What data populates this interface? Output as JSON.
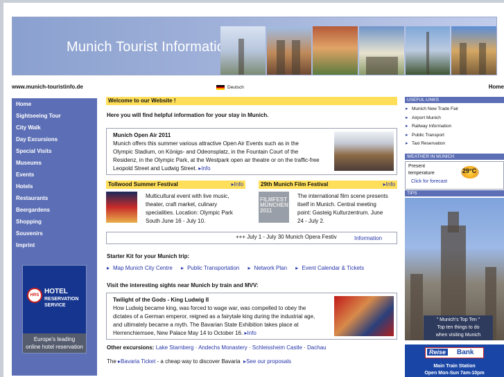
{
  "header": {
    "site_title": "Munich Tourist Information"
  },
  "topbar": {
    "url": "www.munich-touristinfo.de",
    "language": "Deutsch",
    "home": "Home"
  },
  "nav": {
    "items": [
      "Home",
      "Sightseeing Tour",
      "City Walk",
      "Day Excursions",
      "Special Visits",
      "Museums",
      "Events",
      "Hotels",
      "Restaurants",
      "Beergardens",
      "Shopping",
      "Souvenirs",
      "Imprint"
    ]
  },
  "hrs_ad": {
    "logo": "HRS",
    "line1": "HOTEL",
    "line2": "RESERVATION",
    "line3": "SERVICE",
    "caption_1": "Europe's leading",
    "caption_2": "online hotel reservation"
  },
  "main": {
    "welcome": "Welcome to our Website !",
    "intro": "Here you will find helpful information for your stay in Munich.",
    "open_air": {
      "title": "Munich Open Air 2011",
      "lines": [
        "Munich offers this summer various attractive Open Air Events such as in the",
        "Olympic Stadium, on Königs- and Odeonsplatz, in the Fountain Court of the",
        "Residenz, in the Olympic Park, at the Westpark open air theatre or on the traffic-free"
      ],
      "last_line": "Leopold Street and Ludwig Street.",
      "more": "Info"
    },
    "tollwood": {
      "title": "Tollwood Summer Festival",
      "more": "Info",
      "lines": [
        "Multicultural event with live music,",
        "theater, craft market, culinary",
        "specialities. Location: Olympic Park",
        "South June 16 - July 10."
      ]
    },
    "film": {
      "title": "29th Munich Film Festival",
      "more": "Info",
      "image_text": "FILMFEST MÜNCHEN 2011",
      "lines": [
        "The international film scene presents",
        "itself in Munich. Central meeting",
        "point: Gasteig Kulturzentrum. June",
        "24 - July 2."
      ]
    },
    "ticker": {
      "text": "+++ July 1 - July 30 Munich Opera Festiv",
      "link": "Information"
    },
    "starter_title": "Starter Kit for your Munich trip:",
    "starter_links": [
      "Map Munich City Centre",
      "Public Transportation",
      "Network Plan",
      "Event Calendar & Tickets"
    ],
    "sights_title": "Visit the interesting sights near Munich by train and MVV:",
    "ludwig": {
      "title": "Twilight of the Gods - King Ludwig II",
      "lines": [
        "How Ludwig became king, was forced to wage war, was compelled to obey the",
        "dictates of a German emperor, reigned as a fairytale king during the industrial age,",
        "and ultimately became a myth. The Bavarian State Exhibition takes place at"
      ],
      "last_line": "Herrenchiemsee, New Palace May 14 to October 16.",
      "more": "Info"
    },
    "other": {
      "label": "Other excursions:",
      "links": [
        "Lake Starnberg",
        "Andechs Monastery",
        "Schleissheim Castle",
        "Dachau"
      ]
    },
    "bottom": {
      "prefix": "The",
      "ticket_link": "Bavaria Ticket",
      "middle": "- a cheap way to discover Bavaria",
      "proposals_link": "See our proposals"
    }
  },
  "right": {
    "useful_head": "USEFUL LINKS",
    "useful_links": [
      "Munich New Trade Fair",
      "Airport Munich",
      "Railway Information",
      "Public Transport",
      "Taxi Reservation"
    ],
    "weather_head": "WEATHER IN MUNICH",
    "weather_label_1": "Present",
    "weather_label_2": "temperature",
    "weather_temp": "29°C",
    "weather_link": "Click for forecast",
    "tips_head": "TIPS",
    "tips_caption_1": "\" Munich's Top Ten \"",
    "tips_caption_2": "Top ten things to do",
    "tips_caption_3": "when visiting Munich",
    "reisebank": {
      "reise": "Reise",
      "bank": "Bank",
      "line1": "Main Train Station",
      "line2": "Open Mon-Sun 7am-10pm"
    }
  },
  "colors": {
    "nav_bg": "#5c6fb6",
    "highlight": "#ffdf5a",
    "link": "#2333a8"
  }
}
